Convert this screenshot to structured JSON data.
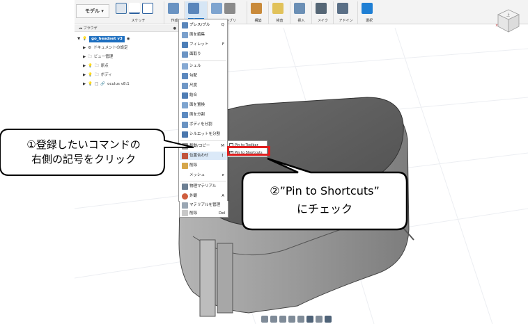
{
  "toolbar": {
    "mode": "モデル",
    "groups": [
      {
        "label": "スケッチ"
      },
      {
        "label": "作成"
      },
      {
        "label": "修正"
      },
      {
        "label": "アセンブリ"
      },
      {
        "label": "構築"
      },
      {
        "label": "検査"
      },
      {
        "label": "挿入"
      },
      {
        "label": "メイク"
      },
      {
        "label": "アドイン"
      },
      {
        "label": "選択"
      }
    ]
  },
  "browser": {
    "title": "ブラウザ",
    "root": "go_headset v3",
    "items": [
      {
        "label": "ドキュメントの設定"
      },
      {
        "label": "ビュー管理"
      },
      {
        "label": "原点"
      },
      {
        "label": "ボディ"
      },
      {
        "label": "oculus v8:1"
      }
    ]
  },
  "menu": {
    "items": [
      {
        "label": "プレス/プル",
        "shortcut": "Q"
      },
      {
        "label": "面を編集",
        "shortcut": ""
      },
      {
        "label": "フィレット",
        "shortcut": "F"
      },
      {
        "label": "面取り",
        "shortcut": ""
      },
      {
        "label": "シェル",
        "shortcut": ""
      },
      {
        "label": "勾配",
        "shortcut": ""
      },
      {
        "label": "尺度",
        "shortcut": ""
      },
      {
        "label": "結合",
        "shortcut": ""
      },
      {
        "label": "面を置換",
        "shortcut": ""
      },
      {
        "label": "面を分割",
        "shortcut": ""
      },
      {
        "label": "ボディを分割",
        "shortcut": ""
      },
      {
        "label": "シルエットを分割",
        "shortcut": ""
      },
      {
        "label": "移動/コピー",
        "shortcut": "M"
      },
      {
        "label": "位置合わせ",
        "shortcut": ""
      },
      {
        "label": "削除",
        "shortcut": ""
      },
      {
        "label": "メッシュ",
        "shortcut": "▸"
      },
      {
        "label": "物理マテリアル",
        "shortcut": ""
      },
      {
        "label": "外観",
        "shortcut": "A"
      },
      {
        "label": "マテリアルを管理",
        "shortcut": ""
      },
      {
        "label": "削除",
        "shortcut": "Del"
      }
    ],
    "more_marker": "⋮"
  },
  "submenu": {
    "items": [
      {
        "label": "Pin to Toolbar",
        "checked": false
      },
      {
        "label": "Pin to Shortcuts",
        "checked": true
      }
    ]
  },
  "callouts": {
    "left": {
      "line1": "①登録したいコマンドの",
      "line2": "右側の記号をクリック"
    },
    "right": {
      "line1": "②”Pin to Shortcuts”",
      "line2": "にチェック"
    }
  },
  "viewcube": {
    "label": "上"
  },
  "colors": {
    "accent": "#1a72c7",
    "highlight": "#e02020",
    "model": "#8c8c8c"
  }
}
